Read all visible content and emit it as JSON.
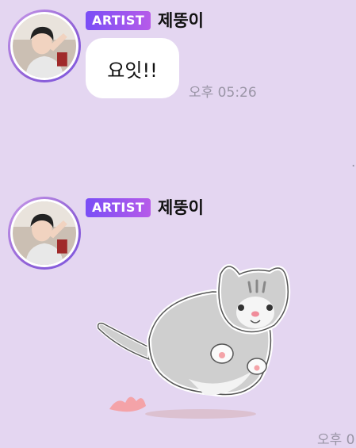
{
  "messages": [
    {
      "badge": "ARTIST",
      "sender": "제뚱이",
      "text": "요잇!!",
      "time": "오후 05:26"
    },
    {
      "badge": "ARTIST",
      "sender": "제뚱이",
      "sticker": "running-cat-sticker",
      "time": "오후 0"
    }
  ],
  "colors": {
    "background": "#e4d6f1",
    "badge_start": "#7a4ef6",
    "badge_end": "#b65be9"
  }
}
